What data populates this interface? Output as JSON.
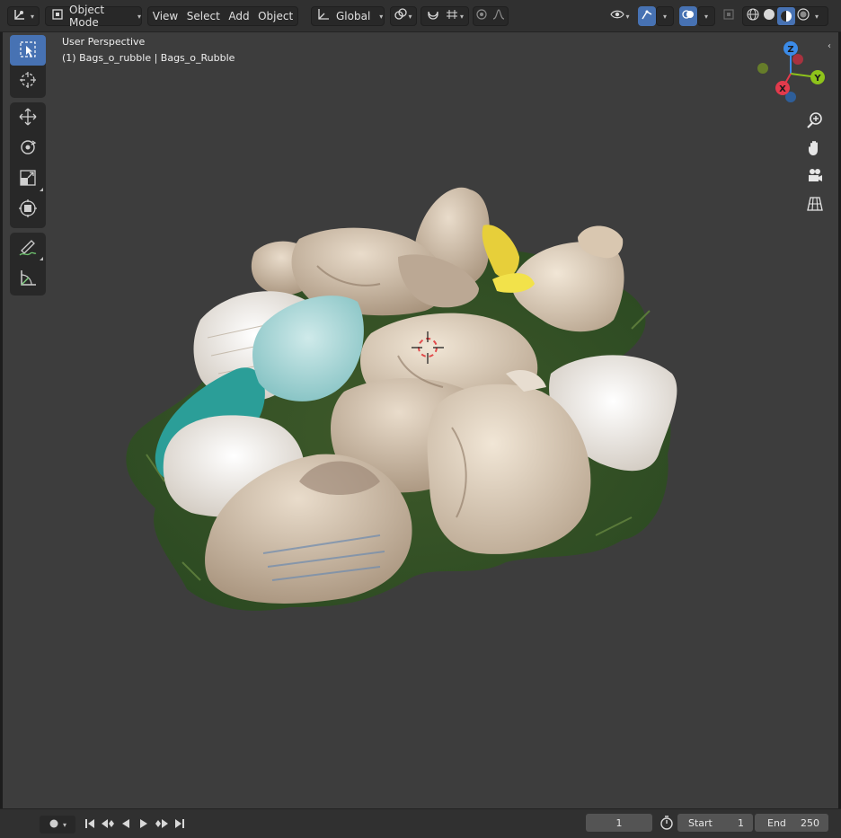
{
  "header": {
    "mode_label": "Object Mode",
    "menus": [
      "View",
      "Select",
      "Add",
      "Object"
    ],
    "orientation_label": "Global"
  },
  "viewport": {
    "perspective_label": "User Perspective",
    "object_label": "(1) Bags_o_rubble | Bags_o_Rubble"
  },
  "gizmo": {
    "x": "X",
    "y": "Y",
    "z": "Z"
  },
  "timeline": {
    "current_frame": "1",
    "start_label": "Start",
    "start_value": "1",
    "end_label": "End",
    "end_value": "250"
  },
  "colors": {
    "accent": "#4772b3",
    "viewport_bg": "#3d3d3d",
    "axis_x": "#e23a4c",
    "axis_y": "#8ec31b",
    "axis_z": "#3b8be8"
  },
  "icons": {
    "editor_type": "editor-type-icon",
    "mode": "object-mode-icon",
    "transform": "transform-orientation-icon",
    "snap": "snap-icon",
    "proportional": "proportional-edit-icon",
    "visibility": "visibility-icon",
    "gizmo_toggle": "gizmo-icon",
    "overlay_toggle": "overlay-icon",
    "xray": "xray-icon",
    "shading": [
      "wireframe-icon",
      "solid-icon",
      "material-preview-icon",
      "rendered-icon"
    ]
  }
}
